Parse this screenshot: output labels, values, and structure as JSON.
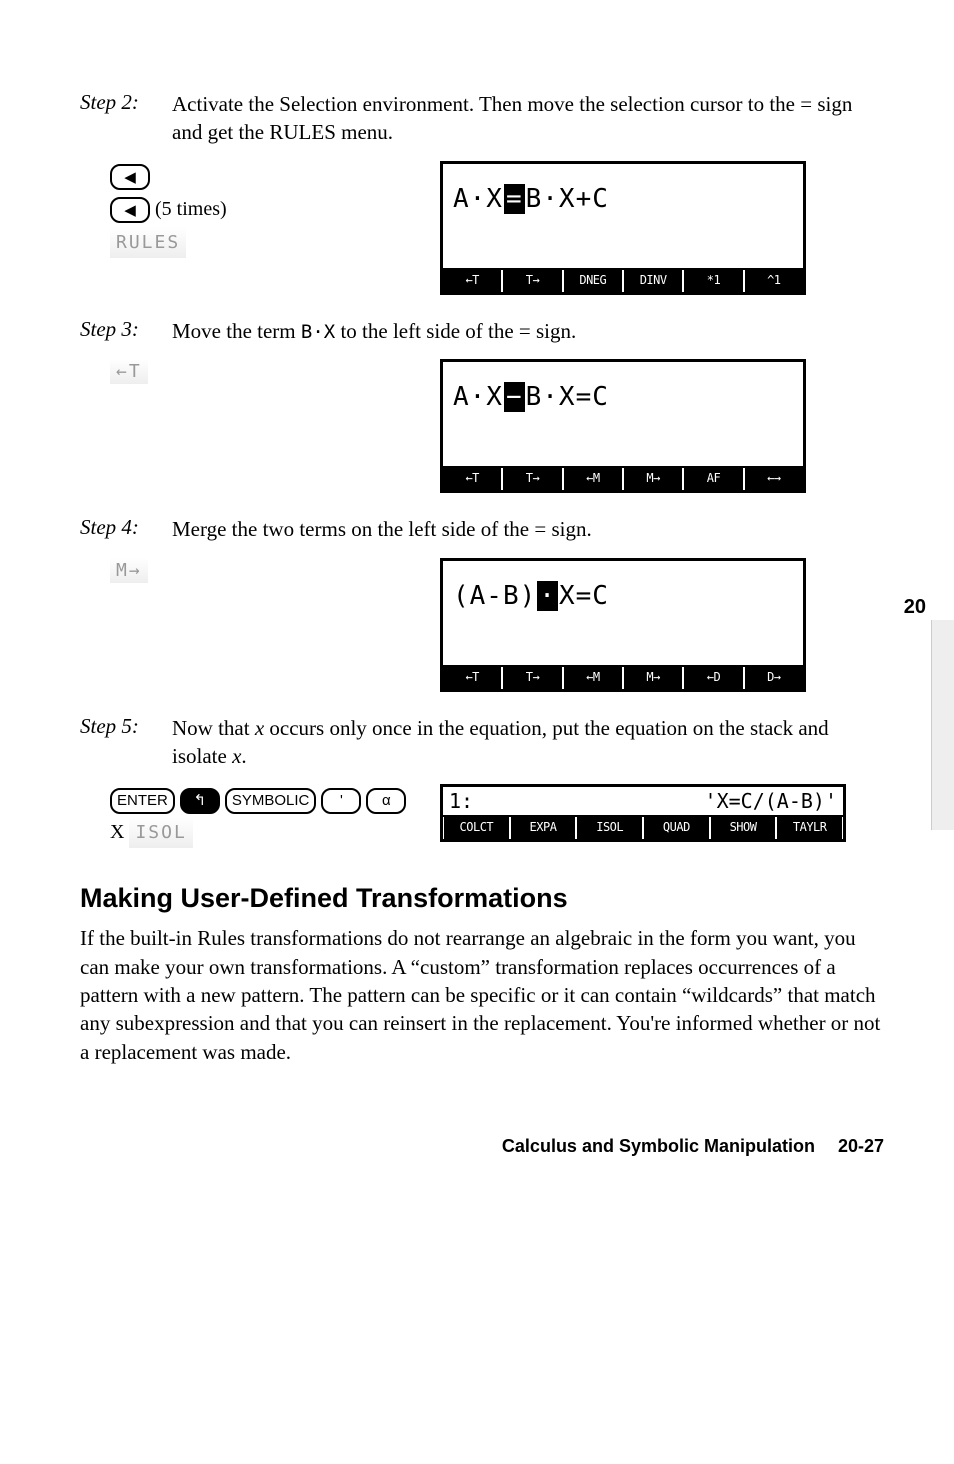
{
  "side_number": "20",
  "steps": {
    "s2": {
      "label": "Step 2:",
      "text": "Activate the Selection environment. Then move the selection cursor to the = sign and get the RULES menu.",
      "keys_note": "(5 times)",
      "softkey": "RULES",
      "screen_formula": "A·X▄B·X+C",
      "menu": [
        "←T",
        "T→",
        "DNEG",
        "DINV",
        "*1",
        "^1"
      ]
    },
    "s3": {
      "label": "Step 3:",
      "text_pre": "Move the term ",
      "text_code": "B·X",
      "text_post": " to the left side of the = sign.",
      "softkey": "←T",
      "screen_formula": "A·X▄B·X=C",
      "menu": [
        "←T",
        "T→",
        "←M",
        "M→",
        "AF",
        "←→"
      ]
    },
    "s4": {
      "label": "Step 4:",
      "text": "Merge the two terms on the left side of the = sign.",
      "softkey": "M→",
      "screen_formula": "(A-B)▮X=C",
      "menu": [
        "←T",
        "T→",
        "←M",
        "M→",
        "←D",
        "D→"
      ]
    },
    "s5": {
      "label": "Step 5:",
      "text_pre": "Now that ",
      "text_x": "x",
      "text_mid": " occurs only once in the equation, put the equation on the stack and isolate ",
      "text_post": ".",
      "key_enter": "ENTER",
      "key_symbolic": "SYMBOLIC",
      "key_tick": "'",
      "key_alpha": "α",
      "softkey_line2_pre": "X ",
      "softkey_line2": "ISOL",
      "stack_level": "1:",
      "stack_value": "'X=C/(A-B)'",
      "menu": [
        "COLCT",
        "EXPA",
        "ISOL",
        "QUAD",
        "SHOW",
        "TAYLR"
      ]
    }
  },
  "section_heading": "Making User-Defined Transformations",
  "section_para": "If the built-in Rules transformations do not rearrange an algebraic in the form you want, you can make your own transformations. A “custom” transformation replaces occurrences of a pattern with a new pattern. The pattern can be specific or it can contain “wildcards” that match any subexpression and that you can reinsert in the replacement. You're informed whether or not a replacement was made.",
  "footer": "Calculus and Symbolic Manipulation  20-27"
}
